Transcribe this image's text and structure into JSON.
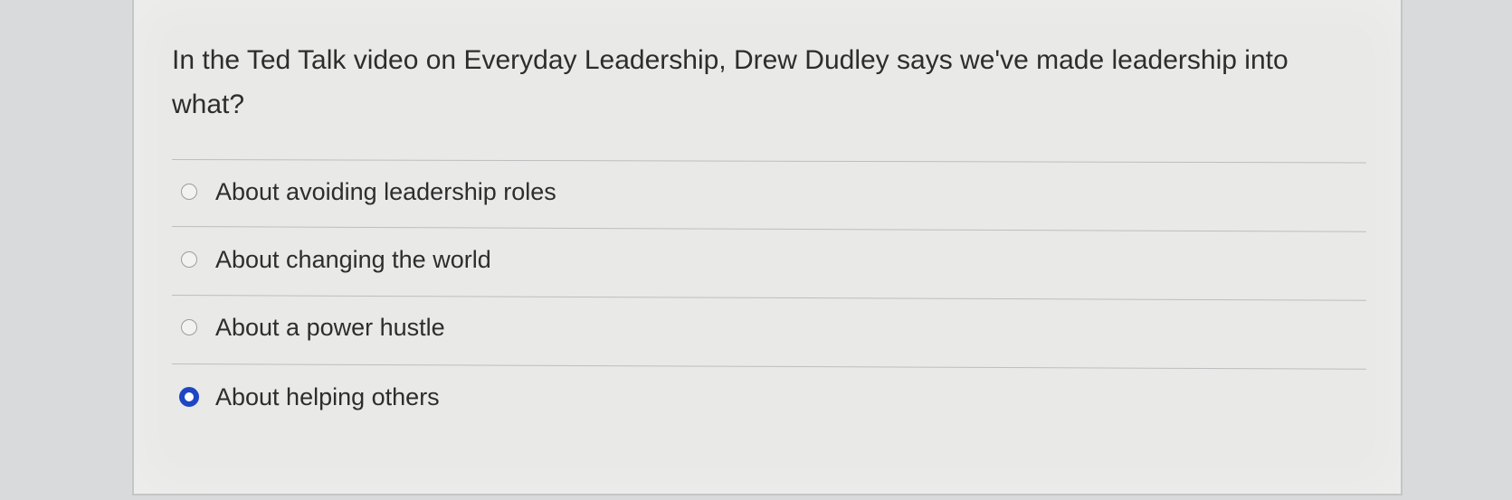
{
  "question": {
    "text": "In the Ted Talk video on Everyday Leadership, Drew Dudley says we've made leadership into what?"
  },
  "answers": [
    {
      "label": "About avoiding leadership roles",
      "selected": false
    },
    {
      "label": "About changing the world",
      "selected": false
    },
    {
      "label": "About a power hustle",
      "selected": false
    },
    {
      "label": "About helping others",
      "selected": true
    }
  ],
  "colors": {
    "selected_radio": "#1d46c4",
    "text": "#2d2d2d"
  }
}
